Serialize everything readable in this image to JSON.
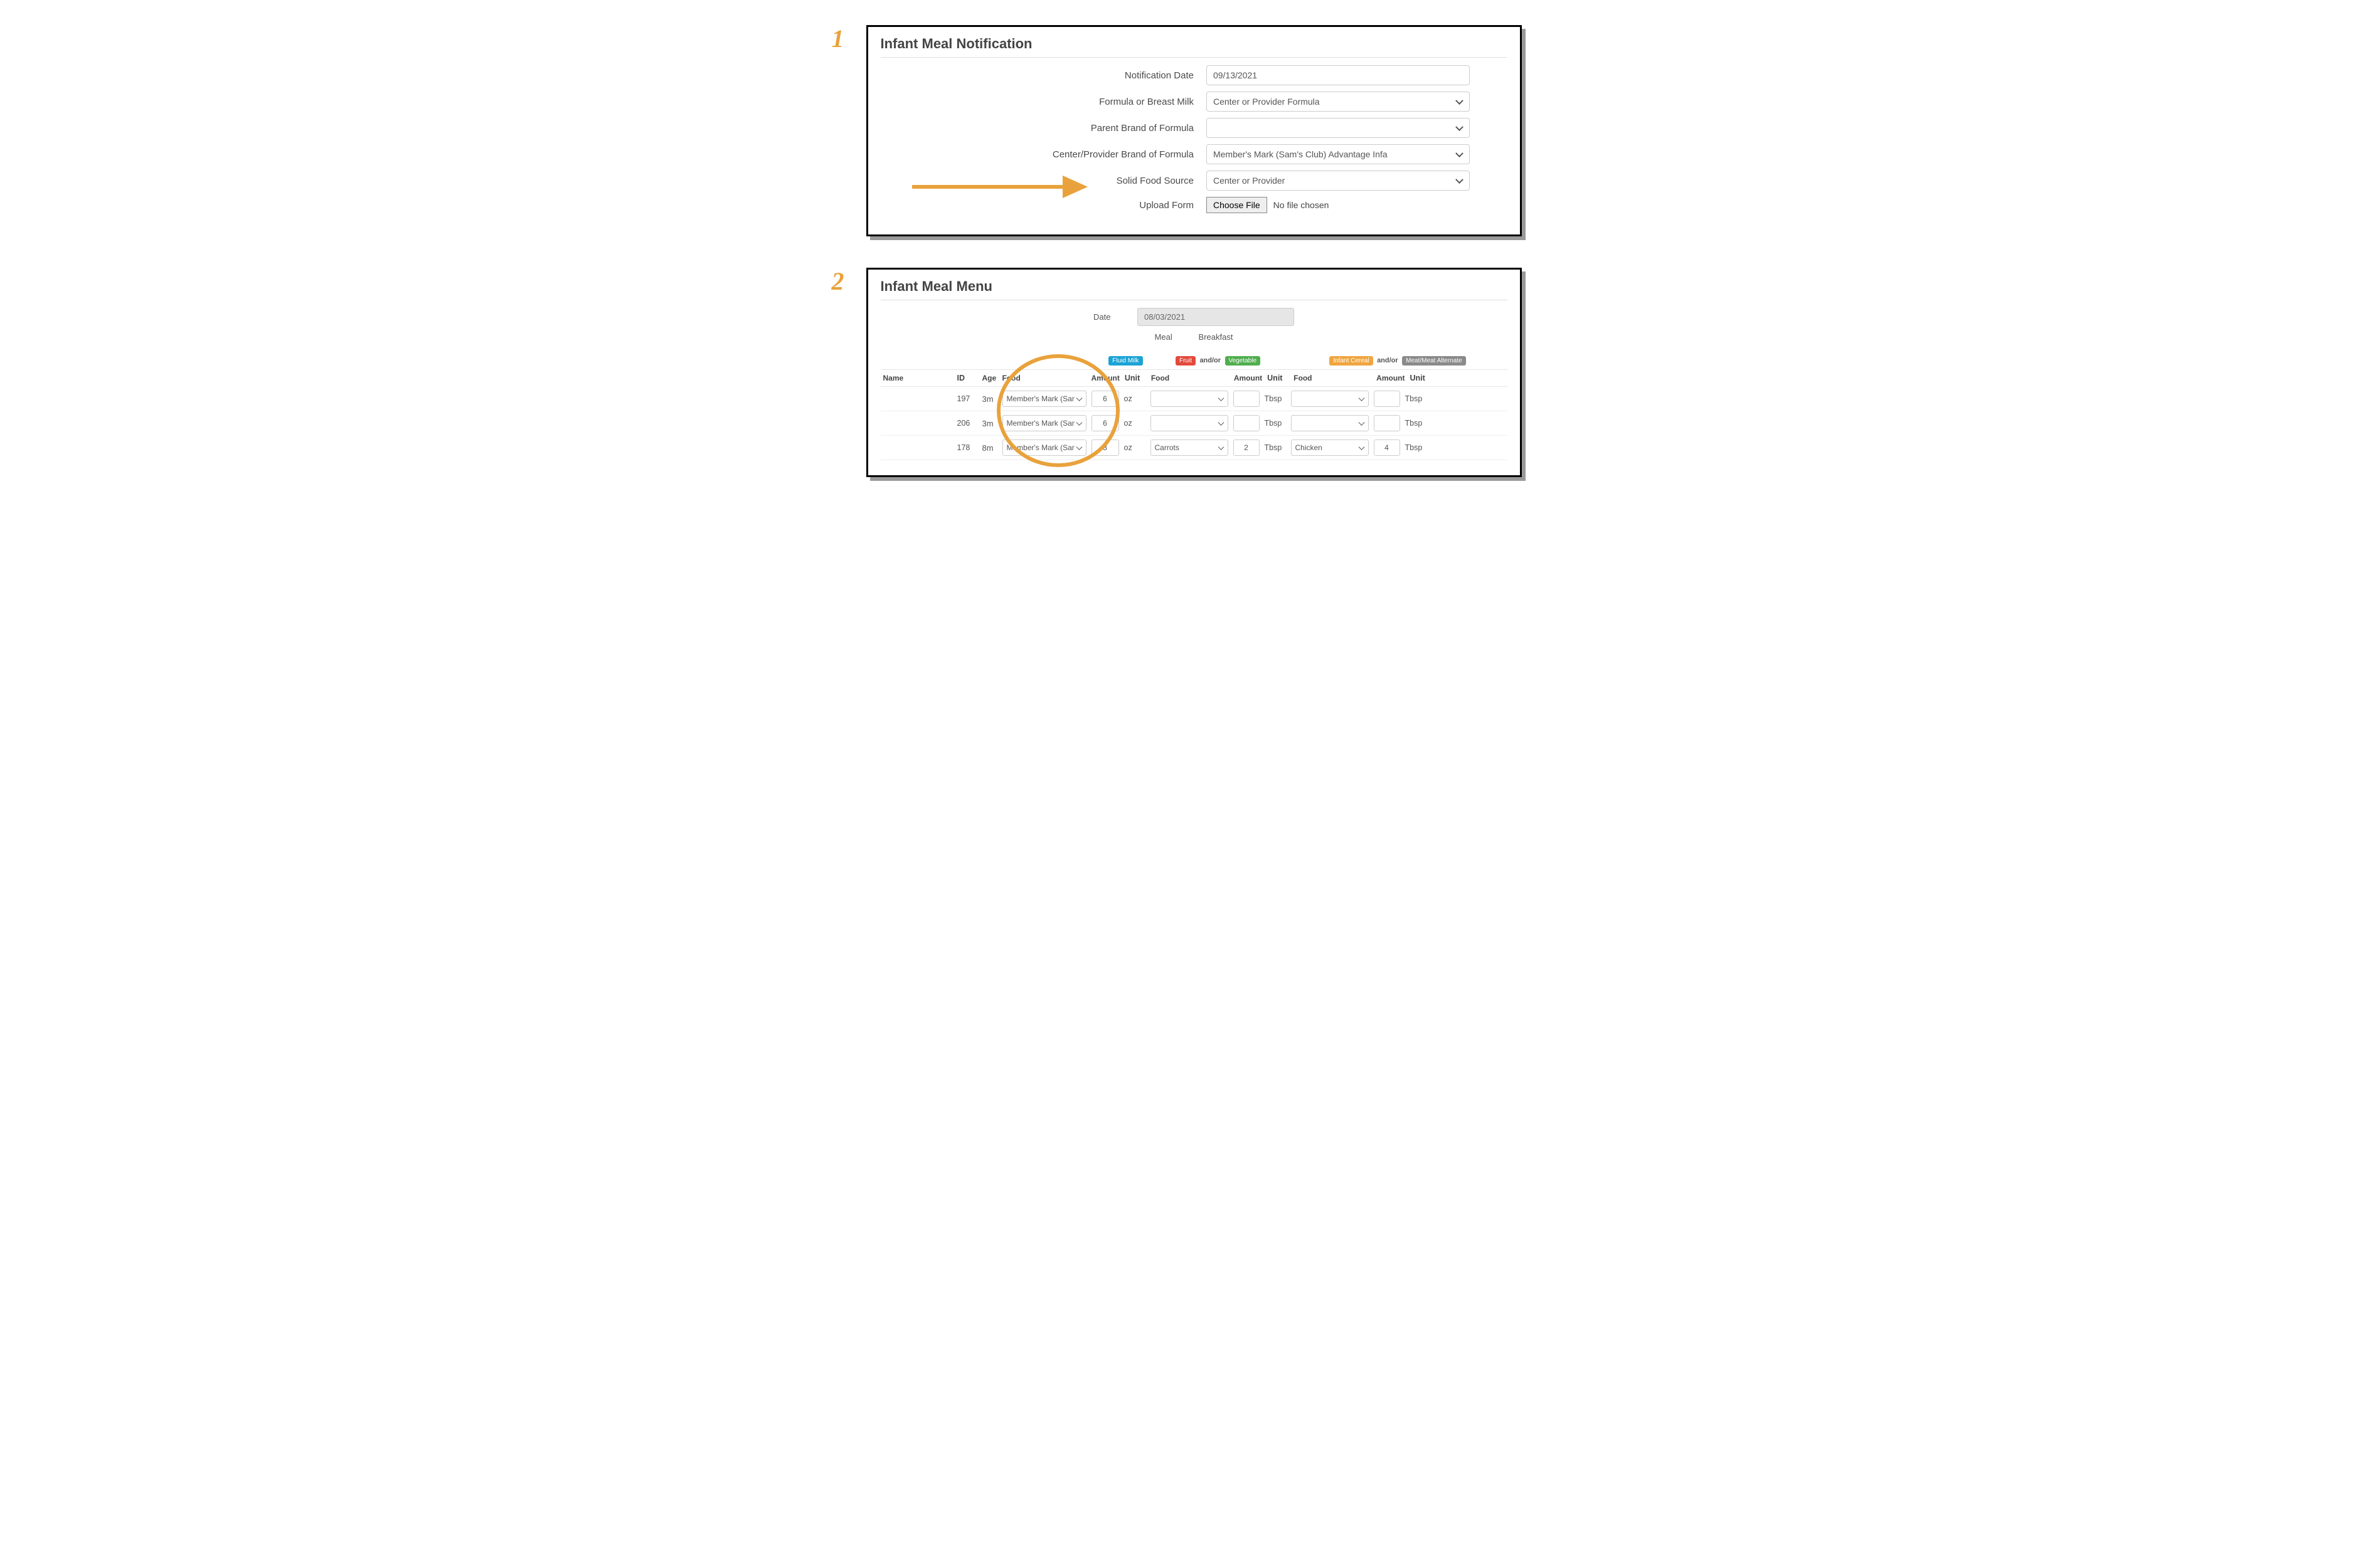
{
  "steps": {
    "step1_num": "1",
    "step2_num": "2"
  },
  "notification": {
    "title": "Infant Meal Notification",
    "labels": {
      "notification_date": "Notification Date",
      "formula_source": "Formula or Breast Milk",
      "parent_brand": "Parent Brand of Formula",
      "provider_brand": "Center/Provider Brand of Formula",
      "solid_food": "Solid Food Source",
      "upload": "Upload Form"
    },
    "values": {
      "notification_date": "09/13/2021",
      "formula_source": "Center or Provider Formula",
      "parent_brand": "",
      "provider_brand": "Member's Mark (Sam's Club) Advantage Infa",
      "solid_food": "Center or Provider"
    },
    "file": {
      "button_label": "Choose File",
      "status": "No file chosen"
    }
  },
  "menu": {
    "title": "Infant Meal Menu",
    "labels": {
      "date": "Date",
      "meal": "Meal"
    },
    "values": {
      "date": "08/03/2021",
      "meal": "Breakfast"
    },
    "group_tags": {
      "fluid_milk": "Fluid Milk",
      "fruit": "Fruit",
      "andor": "and/or",
      "vegetable": "Vegetable",
      "infant_cereal": "Infant Cereal",
      "meat_alt": "Meat/Meat Alternate"
    },
    "columns": {
      "name": "Name",
      "id": "ID",
      "age": "Age",
      "food": "Food",
      "amount": "Amount",
      "unit": "Unit"
    },
    "rows": [
      {
        "id": "197",
        "age": "3m",
        "food1": "Member's Mark (Sam",
        "amount1": "6",
        "unit1": "oz",
        "food2": "",
        "amount2": "",
        "unit2": "Tbsp",
        "food3": "",
        "amount3": "",
        "unit3": "Tbsp"
      },
      {
        "id": "206",
        "age": "3m",
        "food1": "Member's Mark (Sam",
        "amount1": "6",
        "unit1": "oz",
        "food2": "",
        "amount2": "",
        "unit2": "Tbsp",
        "food3": "",
        "amount3": "",
        "unit3": "Tbsp"
      },
      {
        "id": "178",
        "age": "8m",
        "food1": "Member's Mark (Sam",
        "amount1": "8",
        "unit1": "oz",
        "food2": "Carrots",
        "amount2": "2",
        "unit2": "Tbsp",
        "food3": "Chicken",
        "amount3": "4",
        "unit3": "Tbsp"
      }
    ]
  }
}
